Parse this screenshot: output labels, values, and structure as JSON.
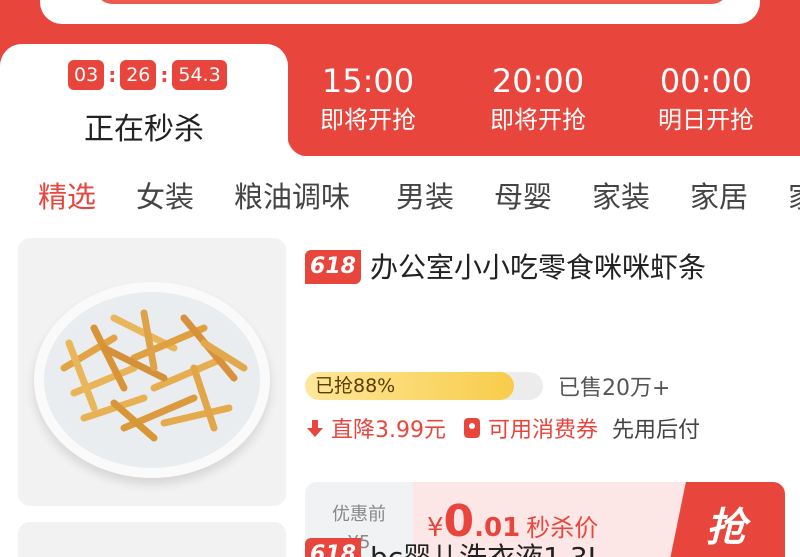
{
  "countdown": {
    "hours": "03",
    "minutes": "26",
    "seconds": "54.3",
    "label": "正在秒杀"
  },
  "sessions": [
    {
      "time": "15:00",
      "status": "即将开抢"
    },
    {
      "time": "20:00",
      "status": "即将开抢"
    },
    {
      "time": "00:00",
      "status": "明日开抢"
    }
  ],
  "categories": [
    "精选",
    "女装",
    "粮油调味",
    "男装",
    "母婴",
    "家装",
    "家居",
    "家"
  ],
  "product": {
    "badge": "618",
    "title": "办公室小小吃零食咪咪虾条",
    "progress_text": "已抢88%",
    "progress_value": 0.88,
    "sold": "已售20万+",
    "price_drop": "直降3.99元",
    "coupon": "可用消费券",
    "pay_later": "先用后付",
    "original_label": "优惠前",
    "original_price": "¥5",
    "currency": "¥",
    "price_int": "0",
    "price_dec": ".01",
    "price_tag": "秒杀价",
    "grab_label": "抢"
  },
  "next_product": {
    "badge": "618",
    "title": "bc婴儿洗衣液1.3L"
  },
  "colors": {
    "accent": "#e8453c",
    "progress": "#f8cc4a"
  }
}
